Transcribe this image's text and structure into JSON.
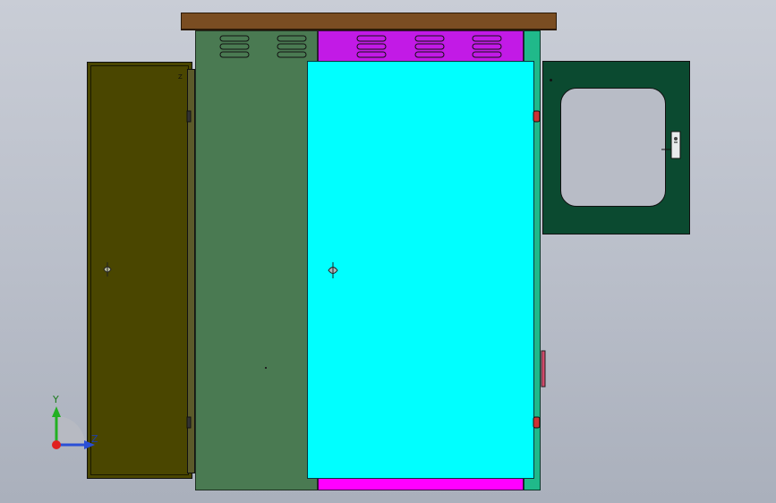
{
  "viewport": {
    "title": "",
    "background_top": "#c9cdd6",
    "background_bottom": "#aab0bc"
  },
  "model": {
    "roof_color": "#7a4d22",
    "left_door_color": "#4a4600",
    "center_body_color": "#4a7a52",
    "upper_panel_color": "#c21ae6",
    "main_door_color": "#00ffff",
    "right_strip_color": "#20b98a",
    "right_hatch_color": "#0b4a30",
    "window_color": "#b8bcc6",
    "bottom_strip_color": "#ff00ff",
    "left_door_mark": "Z"
  },
  "triad": {
    "y_label": "Y",
    "z_label": "Z",
    "y_color": "#22b022",
    "z_color": "#2a4fd6",
    "x_color": "#e02020"
  }
}
